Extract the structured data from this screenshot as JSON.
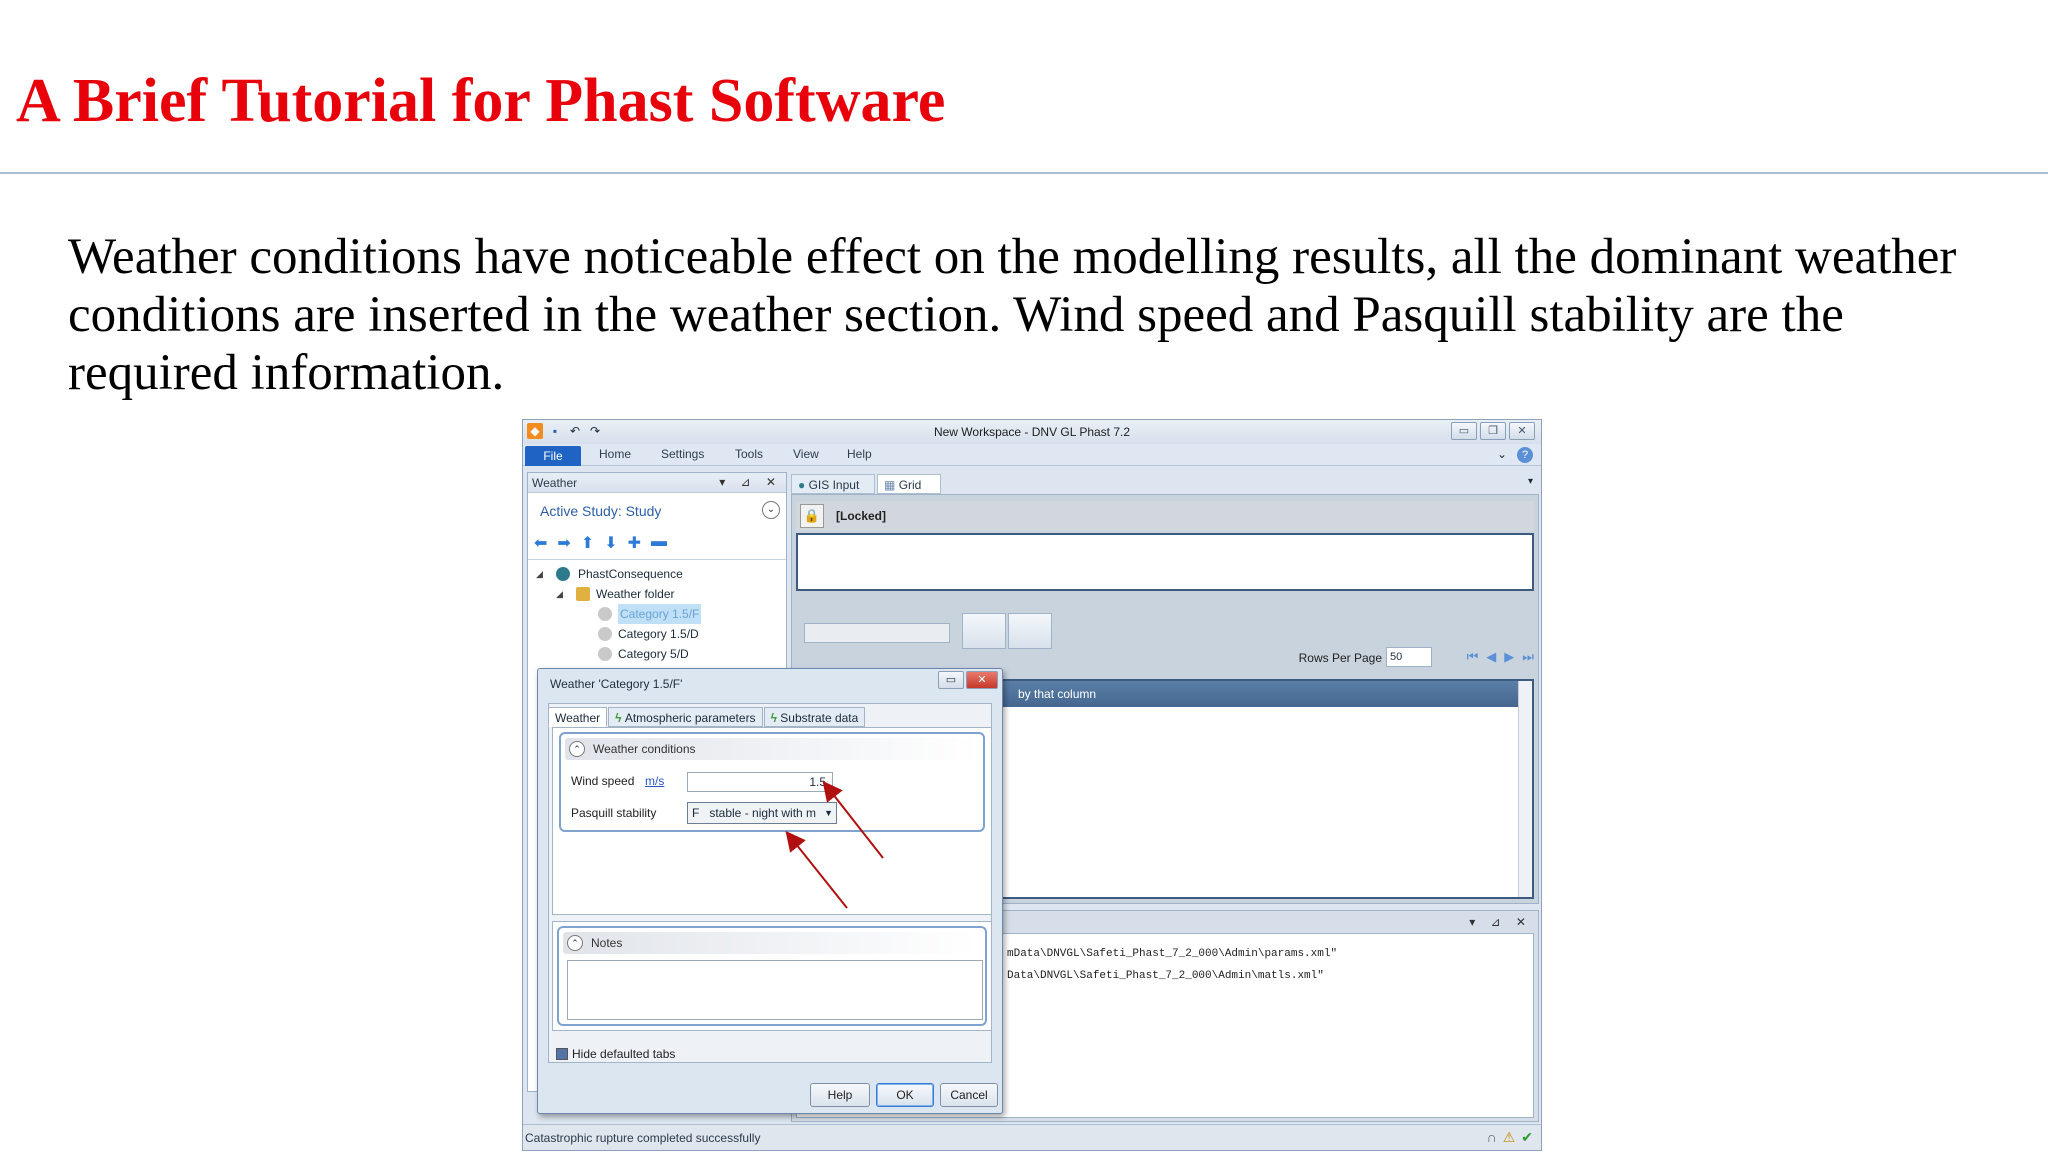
{
  "slide": {
    "title": "A Brief Tutorial for Phast Software",
    "body": "Weather conditions have noticeable effect on the modelling results, all the dominant weather conditions are inserted in the weather section. Wind speed and Pasquill stability are the required information."
  },
  "app": {
    "window_title": "New Workspace - DNV GL Phast 7.2",
    "ribbon_tabs": [
      "File",
      "Home",
      "Settings",
      "Tools",
      "View",
      "Help"
    ],
    "left_pane": {
      "title": "Weather",
      "active_study": "Active Study: Study",
      "tree": [
        {
          "label": "PhastConsequence",
          "level": 0
        },
        {
          "label": "Weather folder",
          "level": 1
        },
        {
          "label": "Category 1.5/F",
          "level": 2,
          "selected": true
        },
        {
          "label": "Category 1.5/D",
          "level": 2
        },
        {
          "label": "Category 5/D",
          "level": 2
        }
      ]
    },
    "doc_tabs": [
      "GIS Input",
      "Grid"
    ],
    "locked_label": "[Locked]",
    "rows_per_page_label": "Rows Per Page",
    "rows_per_page_value": "50",
    "group_hint": "by that column",
    "output_lines": [
      "mData\\DNVGL\\Safeti_Phast_7_2_000\\Admin\\params.xml\"",
      "Data\\DNVGL\\Safeti_Phast_7_2_000\\Admin\\matls.xml\""
    ],
    "status_text": "Catastrophic rupture completed successfully",
    "dialog": {
      "title": "Weather 'Category 1.5/F'",
      "tabs": [
        "Weather",
        "Atmospheric parameters",
        "Substrate data"
      ],
      "group_title": "Weather conditions",
      "wind_speed_label": "Wind speed",
      "wind_speed_unit": "m/s",
      "wind_speed_value": "1.5",
      "pasquill_label": "Pasquill stability",
      "pasquill_value": "F   stable - night with m",
      "notes_title": "Notes",
      "hide_defaulted_label": "Hide defaulted tabs",
      "buttons": {
        "help": "Help",
        "ok": "OK",
        "cancel": "Cancel"
      }
    },
    "annotation_color": "#b01010"
  }
}
